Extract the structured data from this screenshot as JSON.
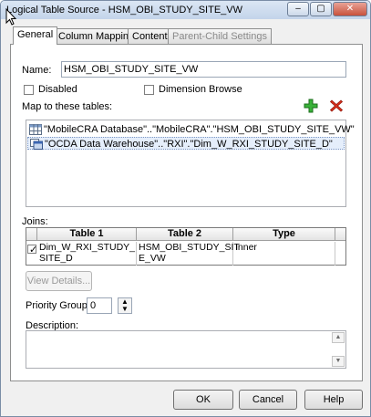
{
  "window": {
    "title": "Logical Table Source - HSM_OBI_STUDY_SITE_VW",
    "minimize": "–",
    "maximize": "▢",
    "close": "✕"
  },
  "tabs": [
    {
      "label": "General",
      "active": true
    },
    {
      "label": "Column Mapping"
    },
    {
      "label": "Content"
    },
    {
      "label": "Parent-Child Settings",
      "disabled": true
    }
  ],
  "general": {
    "name_label": "Name:",
    "name_value": "HSM_OBI_STUDY_SITE_VW",
    "disabled_label": "Disabled",
    "dimension_browse_label": "Dimension Browse",
    "map_label": "Map to these tables:",
    "add_icon": "plus-icon",
    "remove_icon": "red-x-icon",
    "tables": [
      "\"MobileCRA Database\"..\"MobileCRA\".\"HSM_OBI_STUDY_SITE_VW\"",
      "\"OCDA Data Warehouse\"..\"RXI\".\"Dim_W_RXI_STUDY_SITE_D\""
    ],
    "joins_label": "Joins:",
    "joins_headers": [
      "Table 1",
      "Table 2",
      "Type"
    ],
    "joins_rows": [
      {
        "checked": true,
        "table1": "Dim_W_RXI_STUDY_SITE_D",
        "table1_line1": "Dim_W_RXI_STUDY_",
        "table1_line2": "SITE_D",
        "table2_line1": "HSM_OBI_STUDY_SIT",
        "table2_line2": "E_VW",
        "type": "Inner"
      }
    ],
    "view_details": "View Details...",
    "priority_label": "Priority Group:",
    "priority_value": "0",
    "description_label": "Description:"
  },
  "footer": {
    "ok": "OK",
    "cancel": "Cancel",
    "help": "Help"
  },
  "colors": {
    "accent_green": "#2e9e2e",
    "accent_red": "#d42a1a",
    "selection_bg": "#e5eefb"
  }
}
